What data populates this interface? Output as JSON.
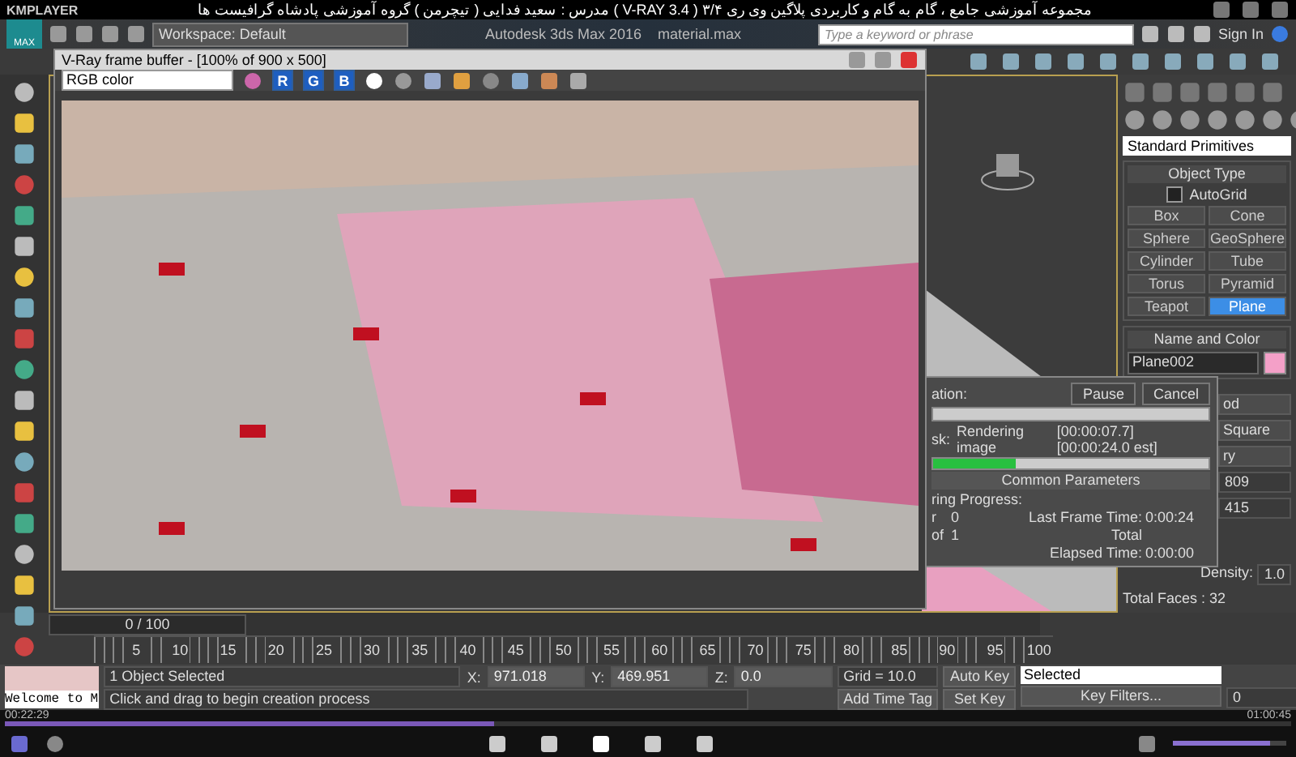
{
  "player": {
    "name": "KMPLAYER",
    "video_title": "مجموعه آموزشی جامع ، گام به گام و کاربردی پلاگین وی ری ۳/۴ ( V-RAY 3.4 )  مدرس : سعید فدایی ( تیچرمن ) گروه آموزشی پادشاه گرافیست ها",
    "time_elapsed": "00:22:29",
    "time_total": "01:00:45",
    "level": 0.38,
    "volume": {
      "level": 0.85
    }
  },
  "app": {
    "logo": "MAX",
    "workspace": "Workspace: Default",
    "title": "Autodesk 3ds Max 2016    material.max",
    "search": {
      "placeholder": "Type a keyword or phrase"
    },
    "sign_in": "Sign In"
  },
  "frame_buffer": {
    "title": "V-Ray frame buffer - [100% of 900 x 500]",
    "channel": "RGB color",
    "channel_buttons": [
      {
        "label": "R",
        "selected": true
      },
      {
        "label": "G",
        "selected": true
      },
      {
        "label": "B",
        "selected": true
      }
    ]
  },
  "render_dialog": {
    "rows": [
      "ation:"
    ],
    "overall": {
      "level": 0
    },
    "buttons": [
      "Pause",
      "Cancel"
    ],
    "task_label": "sk:",
    "task": "Rendering image",
    "task_time": "[00:00:07.7] [00:00:24.0 est]",
    "progress": {
      "level": 0.3
    },
    "section": "Common Parameters",
    "progress_label": "ring Progress:",
    "stats": [
      {
        "label": "r",
        "value": "0",
        "key": "Last Frame Time:",
        "time": "0:00:24"
      },
      {
        "label": "of",
        "value": "1",
        "key": "Total"
      },
      {
        "key": "Elapsed Time:",
        "time": "0:00:00"
      }
    ]
  },
  "command_panel": {
    "category": "Standard Primitives",
    "object_type": {
      "title": "Object Type",
      "autogrid": {
        "label": "AutoGrid",
        "checked": false
      },
      "buttons": [
        {
          "label": "Box",
          "selected": false
        },
        {
          "label": "Cone",
          "selected": false
        },
        {
          "label": "Sphere",
          "selected": false
        },
        {
          "label": "GeoSphere",
          "selected": false
        },
        {
          "label": "Cylinder",
          "selected": false
        },
        {
          "label": "Tube",
          "selected": false
        },
        {
          "label": "Torus",
          "selected": false
        },
        {
          "label": "Pyramid",
          "selected": false
        },
        {
          "label": "Teapot",
          "selected": false
        },
        {
          "label": "Plane",
          "selected": true
        }
      ]
    },
    "name_and_color": {
      "title": "Name and Color",
      "name": "Plane002",
      "color": "#f4a0c8"
    },
    "partial_items": [
      "od",
      "Square",
      "ry"
    ],
    "spinners": [
      "809",
      "415"
    ],
    "density": {
      "label": "Density:",
      "value": "1.0"
    },
    "total_faces": "Total Faces : 32"
  },
  "timeline": {
    "position": "0 / 100",
    "level": 0,
    "ticks": [
      "5",
      "10",
      "15",
      "20",
      "25",
      "30",
      "35",
      "40",
      "45",
      "50",
      "55",
      "60",
      "65",
      "70",
      "75",
      "80",
      "85",
      "90",
      "95",
      "100"
    ]
  },
  "status_bar": {
    "script": "Welcome to M",
    "selection": "1 Object Selected",
    "prompt": "Click and drag to begin creation process",
    "x": {
      "label": "X:",
      "value": "971.018"
    },
    "y": {
      "label": "Y:",
      "value": "469.951"
    },
    "z": {
      "label": "Z:",
      "value": "0.0"
    },
    "grid": "Grid = 10.0",
    "add_time_tag": "Add Time Tag",
    "auto_key": "Auto Key",
    "key_mode": "Selected",
    "set_key": "Set Key",
    "key_filters": "Key Filters...",
    "frame": "0"
  }
}
